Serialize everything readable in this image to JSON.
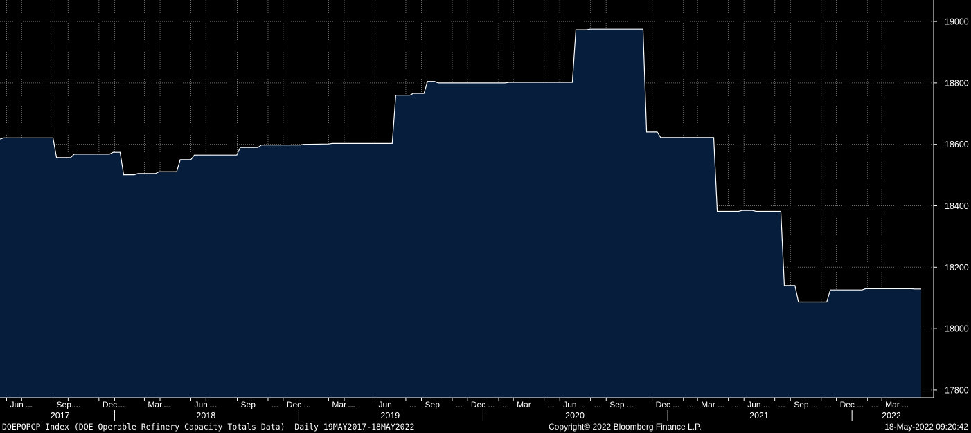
{
  "chart_data": {
    "type": "area",
    "ticker": "DOEPOPCP Index (DOE Operable Refinery Capacity Totals Data)",
    "frequency": "Daily 19MAY2017-18MAY2022",
    "copyright": "Copyright© 2022 Bloomberg Finance L.P.",
    "timestamp": "18-May-2022 09:20:42",
    "ylim": [
      17775,
      19070
    ],
    "yticks": [
      17800,
      18000,
      18200,
      18400,
      18600,
      18800,
      19000
    ],
    "xlim": [
      "2017-05-19",
      "2022-05-18"
    ],
    "grid": true,
    "month_ticks": [
      {
        "date": "2017-06-01",
        "label": "Jun ..."
      },
      {
        "date": "2017-07-01",
        "label": "..."
      },
      {
        "date": "2017-09-01",
        "label": "Sep ..."
      },
      {
        "date": "2017-10-01",
        "label": "..."
      },
      {
        "date": "2017-12-01",
        "label": "Dec ..."
      },
      {
        "date": "2018-01-01",
        "label": "..."
      },
      {
        "date": "2018-03-01",
        "label": "Mar ..."
      },
      {
        "date": "2018-04-01",
        "label": "..."
      },
      {
        "date": "2018-06-01",
        "label": "Jun ..."
      },
      {
        "date": "2018-07-01",
        "label": "..."
      },
      {
        "date": "2018-09-01",
        "label": "Sep"
      },
      {
        "date": "2018-11-01",
        "label": "..."
      },
      {
        "date": "2018-12-01",
        "label": "Dec ..."
      },
      {
        "date": "2019-03-01",
        "label": "Mar ..."
      },
      {
        "date": "2019-04-01",
        "label": "..."
      },
      {
        "date": "2019-06-01",
        "label": "Jun"
      },
      {
        "date": "2019-08-01",
        "label": "..."
      },
      {
        "date": "2019-09-01",
        "label": "Sep"
      },
      {
        "date": "2019-11-01",
        "label": "..."
      },
      {
        "date": "2019-12-01",
        "label": "Dec ..."
      },
      {
        "date": "2020-02-01",
        "label": "..."
      },
      {
        "date": "2020-03-01",
        "label": "Mar"
      },
      {
        "date": "2020-05-01",
        "label": "..."
      },
      {
        "date": "2020-06-01",
        "label": "Jun ..."
      },
      {
        "date": "2020-08-01",
        "label": "..."
      },
      {
        "date": "2020-09-01",
        "label": "Sep ..."
      },
      {
        "date": "2020-12-01",
        "label": "Dec ..."
      },
      {
        "date": "2021-02-01",
        "label": "..."
      },
      {
        "date": "2021-03-01",
        "label": "Mar ..."
      },
      {
        "date": "2021-05-01",
        "label": "..."
      },
      {
        "date": "2021-06-01",
        "label": "Jun ..."
      },
      {
        "date": "2021-08-01",
        "label": "..."
      },
      {
        "date": "2021-09-01",
        "label": "Sep ..."
      },
      {
        "date": "2021-11-01",
        "label": "..."
      },
      {
        "date": "2021-12-01",
        "label": "Dec ..."
      },
      {
        "date": "2022-02-01",
        "label": "..."
      },
      {
        "date": "2022-03-01",
        "label": "Mar ..."
      }
    ],
    "years": [
      {
        "label": "2017",
        "date": "2017-09-15",
        "boundary": "2018-01-01"
      },
      {
        "label": "2018",
        "date": "2018-07-01",
        "boundary": "2019-01-01"
      },
      {
        "label": "2019",
        "date": "2019-07-01",
        "boundary": "2020-01-01"
      },
      {
        "label": "2020",
        "date": "2020-07-01",
        "boundary": "2021-01-01"
      },
      {
        "label": "2021",
        "date": "2021-07-01",
        "boundary": "2022-01-01"
      },
      {
        "label": "2022",
        "date": "2022-03-20",
        "boundary": null
      }
    ],
    "series": [
      {
        "points": [
          [
            "2017-05-19",
            18617
          ],
          [
            "2017-05-26",
            18621
          ],
          [
            "2017-09-01",
            18621
          ],
          [
            "2017-09-08",
            18557
          ],
          [
            "2017-10-06",
            18557
          ],
          [
            "2017-10-13",
            18568
          ],
          [
            "2017-12-22",
            18568
          ],
          [
            "2017-12-29",
            18574
          ],
          [
            "2018-01-12",
            18574
          ],
          [
            "2018-01-19",
            18501
          ],
          [
            "2018-02-09",
            18501
          ],
          [
            "2018-02-16",
            18505
          ],
          [
            "2018-03-23",
            18505
          ],
          [
            "2018-03-30",
            18511
          ],
          [
            "2018-05-04",
            18511
          ],
          [
            "2018-05-11",
            18550
          ],
          [
            "2018-06-01",
            18550
          ],
          [
            "2018-06-08",
            18565
          ],
          [
            "2018-08-31",
            18565
          ],
          [
            "2018-09-07",
            18590
          ],
          [
            "2018-10-12",
            18590
          ],
          [
            "2018-10-19",
            18598
          ],
          [
            "2019-01-04",
            18598
          ],
          [
            "2019-01-11",
            18600
          ],
          [
            "2019-03-01",
            18601
          ],
          [
            "2019-03-08",
            18603
          ],
          [
            "2019-07-05",
            18603
          ],
          [
            "2019-07-12",
            18760
          ],
          [
            "2019-08-09",
            18760
          ],
          [
            "2019-08-16",
            18766
          ],
          [
            "2019-09-06",
            18766
          ],
          [
            "2019-09-13",
            18805
          ],
          [
            "2019-09-27",
            18805
          ],
          [
            "2019-10-04",
            18800
          ],
          [
            "2020-02-14",
            18800
          ],
          [
            "2020-02-21",
            18802
          ],
          [
            "2020-06-26",
            18802
          ],
          [
            "2020-07-03",
            18973
          ],
          [
            "2020-07-24",
            18973
          ],
          [
            "2020-07-31",
            18975
          ],
          [
            "2020-11-13",
            18975
          ],
          [
            "2020-11-20",
            18640
          ],
          [
            "2020-12-11",
            18640
          ],
          [
            "2020-12-18",
            18622
          ],
          [
            "2021-04-02",
            18622
          ],
          [
            "2021-04-09",
            18382
          ],
          [
            "2021-05-21",
            18382
          ],
          [
            "2021-05-28",
            18385
          ],
          [
            "2021-06-18",
            18385
          ],
          [
            "2021-06-25",
            18382
          ],
          [
            "2021-08-13",
            18382
          ],
          [
            "2021-08-20",
            18140
          ],
          [
            "2021-09-10",
            18140
          ],
          [
            "2021-09-17",
            18087
          ],
          [
            "2021-11-12",
            18087
          ],
          [
            "2021-11-19",
            18126
          ],
          [
            "2022-01-21",
            18126
          ],
          [
            "2022-01-28",
            18130
          ],
          [
            "2022-04-29",
            18130
          ],
          [
            "2022-05-06",
            18129
          ],
          [
            "2022-05-18",
            18129
          ]
        ],
        "color": "#ffffff",
        "fill": "#061e3b"
      }
    ]
  }
}
